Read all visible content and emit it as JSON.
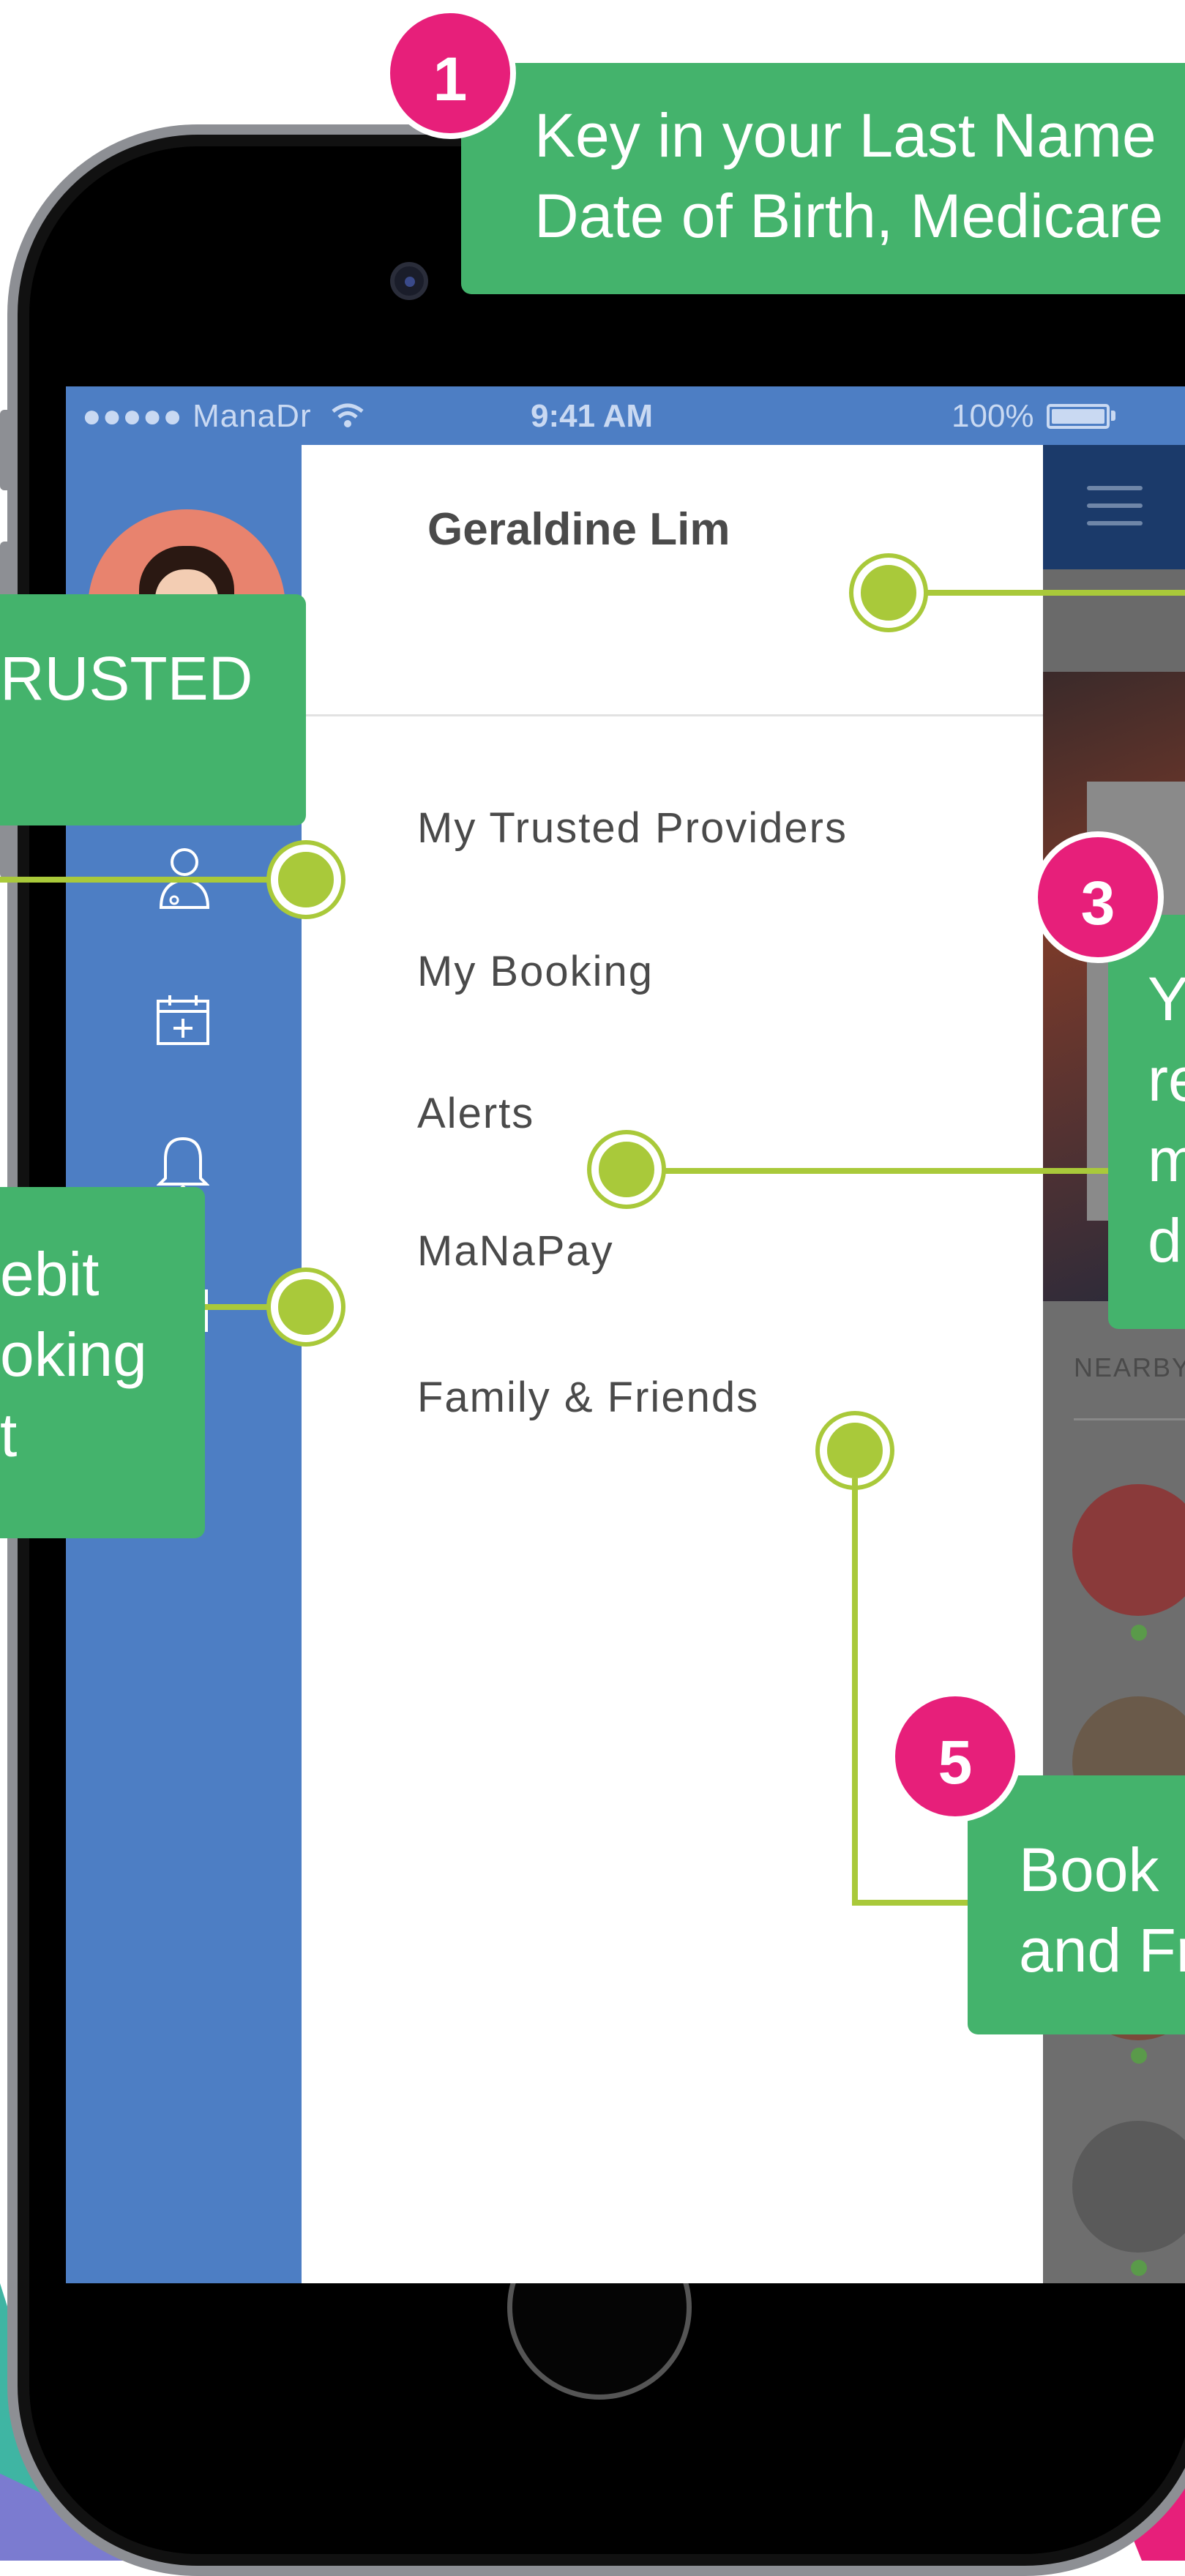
{
  "status_bar": {
    "carrier": "●●●●● ManaDr",
    "time": "9:41 AM",
    "battery": "100%"
  },
  "drawer": {
    "user_name": "Geraldine Lim",
    "menu": [
      {
        "label": "My Trusted Providers"
      },
      {
        "label": "My Booking"
      },
      {
        "label": "Alerts"
      },
      {
        "label": "MaNaPay"
      },
      {
        "label": "Family & Friends"
      }
    ]
  },
  "background_app": {
    "section_label": "NEARBY"
  },
  "callouts": {
    "step1": {
      "number": "1",
      "text": "Key in your Last Name\nDate of Birth, Medicare"
    },
    "step2": {
      "text": "RUSTED"
    },
    "step3": {
      "number": "3",
      "text": "Y\nre\nm\nd"
    },
    "step4": {
      "text": "ebit\noking\nt"
    },
    "step5": {
      "number": "5",
      "text": "Book \nand Fr"
    }
  },
  "colors": {
    "accent_green": "#44b36c",
    "badge_pink": "#e71f7a",
    "connector_lime": "#a9c93a",
    "sidebar_blue": "#4d7ec4"
  }
}
